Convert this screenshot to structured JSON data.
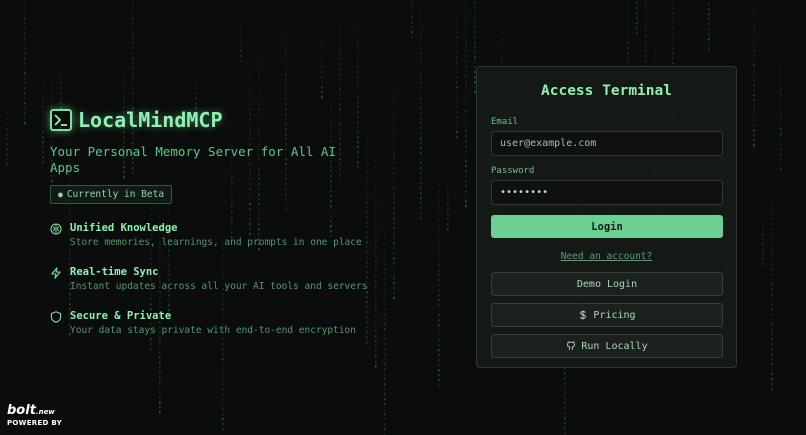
{
  "brand": {
    "title": "LocalMindMCP",
    "icon": "terminal-icon"
  },
  "hero": {
    "tagline": "Your Personal Memory Server for All AI Apps",
    "badge": "Currently in Beta"
  },
  "features": [
    {
      "icon": "brain-icon",
      "title": "Unified Knowledge",
      "desc": "Store memories, learnings, and prompts in one place"
    },
    {
      "icon": "zap-icon",
      "title": "Real-time Sync",
      "desc": "Instant updates across all your AI tools and servers"
    },
    {
      "icon": "shield-icon",
      "title": "Secure & Private",
      "desc": "Your data stays private with end-to-end encryption"
    }
  ],
  "panel": {
    "title": "Access Terminal",
    "email_label": "Email",
    "email_placeholder": "user@example.com",
    "password_label": "Password",
    "password_value": "password",
    "login_label": "Login",
    "need_account": "Need an account?",
    "demo_label": "Demo Login",
    "pricing_label": "Pricing",
    "local_label": "Run Locally"
  },
  "footer": {
    "logo": "bolt",
    "logo_tld": ".new",
    "powered": "POWERED BY"
  },
  "colors": {
    "accent": "#7ee0a0",
    "button": "#6ccf94",
    "background": "#0a0d0b",
    "panel": "#161a17"
  }
}
